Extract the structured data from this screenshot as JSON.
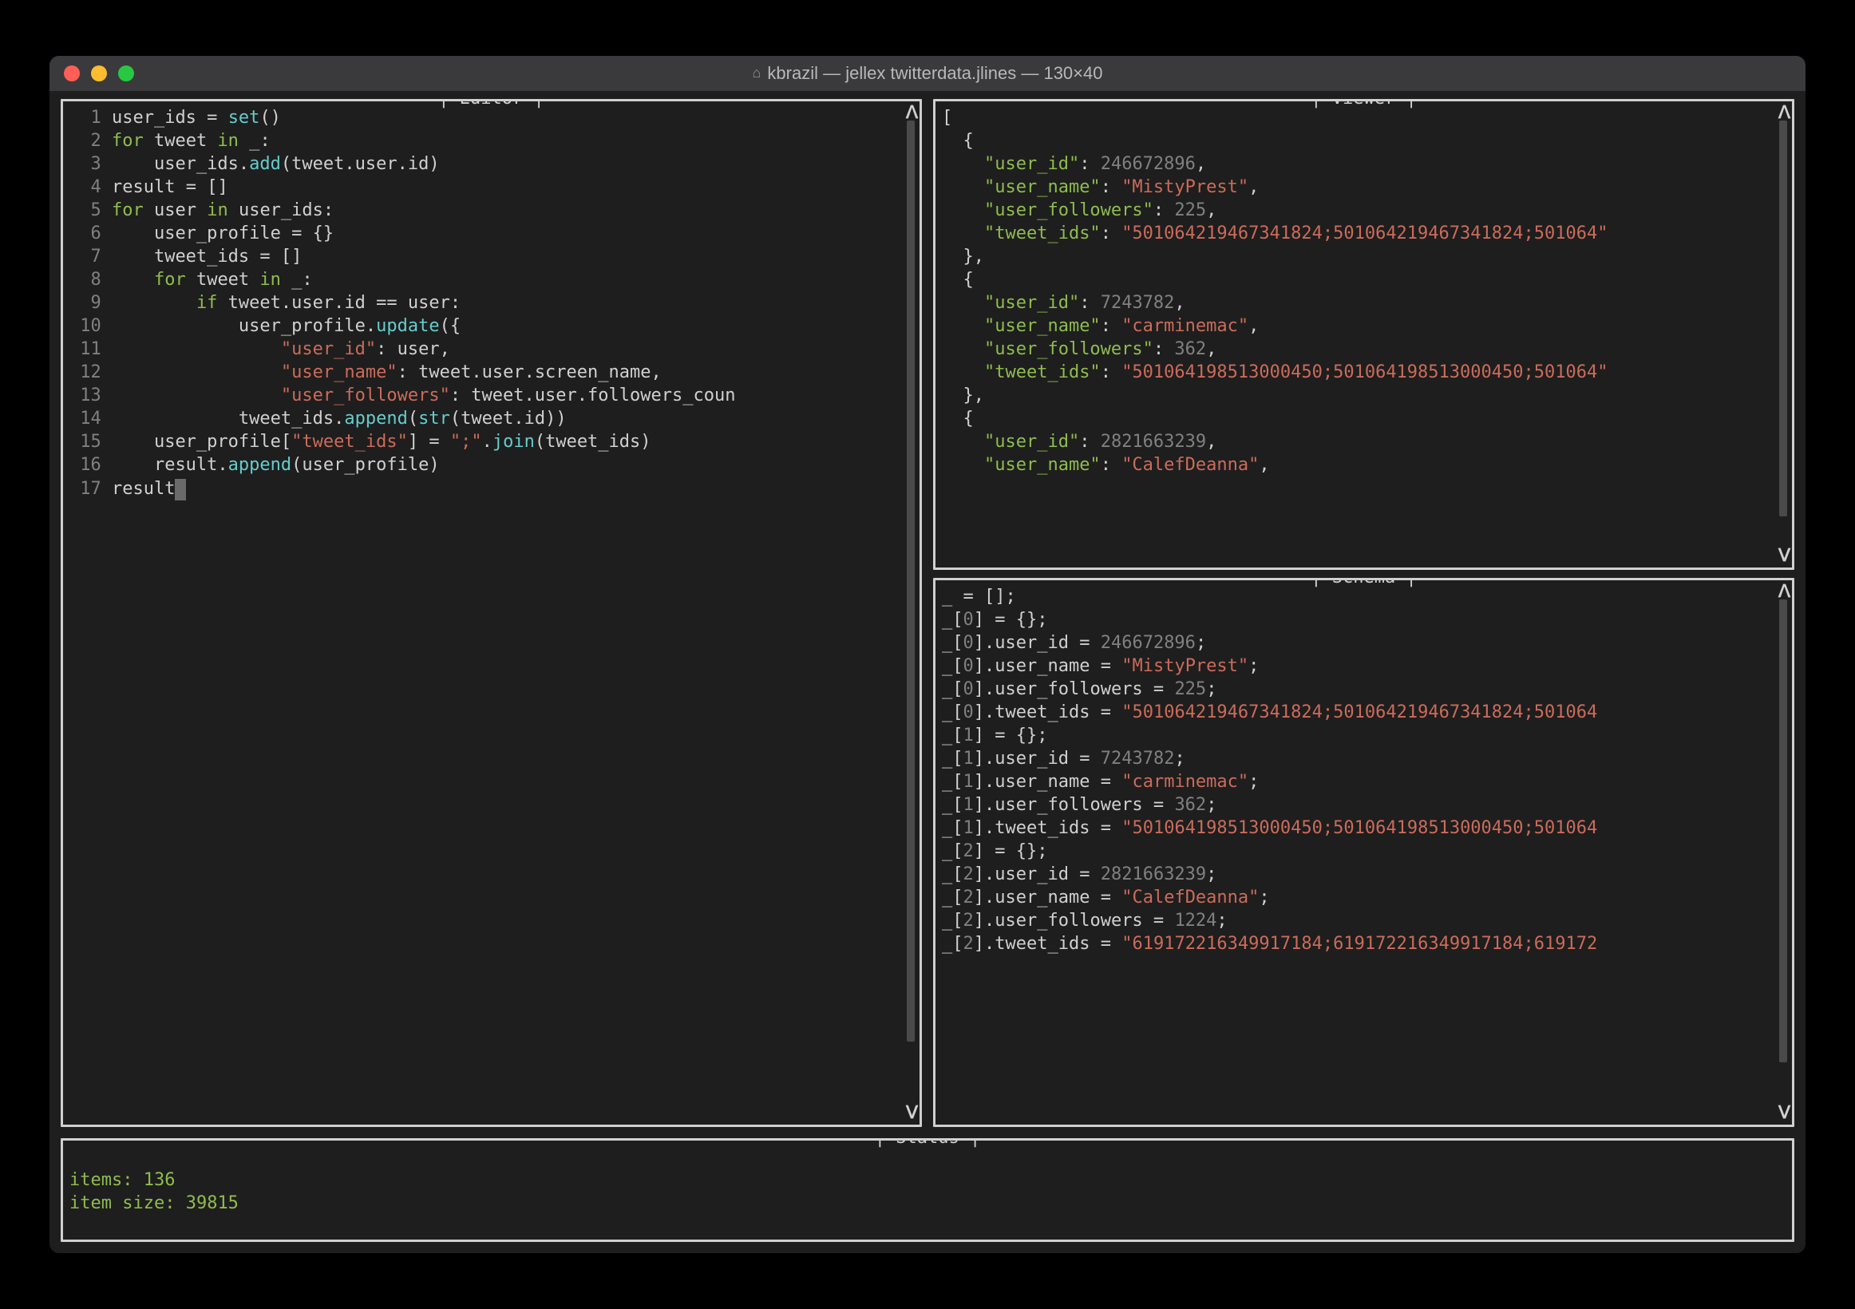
{
  "window": {
    "title_prefix": "kbrazil",
    "title_command": "jellex twitterdata.jlines",
    "title_dims": "130×40"
  },
  "panes": {
    "editor_label": "| Editor |",
    "viewer_label": "| Viewer |",
    "schema_label": "| Schema |",
    "status_label": "| Status |"
  },
  "editor": {
    "lines": [
      {
        "n": 1,
        "tokens": [
          [
            "id",
            "user_ids"
          ],
          [
            "op",
            " = "
          ],
          [
            "fn",
            "set"
          ],
          [
            "pn",
            "()"
          ]
        ]
      },
      {
        "n": 2,
        "tokens": [
          [
            "kw",
            "for"
          ],
          [
            "id",
            " tweet "
          ],
          [
            "kw",
            "in"
          ],
          [
            "id",
            " _"
          ],
          [
            "pn",
            ":"
          ]
        ]
      },
      {
        "n": 3,
        "tokens": [
          [
            "id",
            "    user_ids"
          ],
          [
            "op",
            "."
          ],
          [
            "fn",
            "add"
          ],
          [
            "pn",
            "("
          ],
          [
            "id",
            "tweet"
          ],
          [
            "op",
            "."
          ],
          [
            "id",
            "user"
          ],
          [
            "op",
            "."
          ],
          [
            "id",
            "id"
          ],
          [
            "pn",
            ")"
          ]
        ]
      },
      {
        "n": 4,
        "tokens": [
          [
            "id",
            "result"
          ],
          [
            "op",
            " = "
          ],
          [
            "pn",
            "[]"
          ]
        ]
      },
      {
        "n": 5,
        "tokens": [
          [
            "kw",
            "for"
          ],
          [
            "id",
            " user "
          ],
          [
            "kw",
            "in"
          ],
          [
            "id",
            " user_ids"
          ],
          [
            "pn",
            ":"
          ]
        ]
      },
      {
        "n": 6,
        "tokens": [
          [
            "id",
            "    user_profile"
          ],
          [
            "op",
            " = "
          ],
          [
            "pn",
            "{}"
          ]
        ]
      },
      {
        "n": 7,
        "tokens": [
          [
            "id",
            "    tweet_ids"
          ],
          [
            "op",
            " = "
          ],
          [
            "pn",
            "[]"
          ]
        ]
      },
      {
        "n": 8,
        "tokens": [
          [
            "id",
            "    "
          ],
          [
            "kw",
            "for"
          ],
          [
            "id",
            " tweet "
          ],
          [
            "kw",
            "in"
          ],
          [
            "id",
            " _"
          ],
          [
            "pn",
            ":"
          ]
        ]
      },
      {
        "n": 9,
        "tokens": [
          [
            "id",
            "        "
          ],
          [
            "kw",
            "if"
          ],
          [
            "id",
            " tweet"
          ],
          [
            "op",
            "."
          ],
          [
            "id",
            "user"
          ],
          [
            "op",
            "."
          ],
          [
            "id",
            "id"
          ],
          [
            "op",
            " == "
          ],
          [
            "id",
            "user"
          ],
          [
            "pn",
            ":"
          ]
        ]
      },
      {
        "n": 10,
        "tokens": [
          [
            "id",
            "            user_profile"
          ],
          [
            "op",
            "."
          ],
          [
            "fn",
            "update"
          ],
          [
            "pn",
            "({"
          ]
        ]
      },
      {
        "n": 11,
        "tokens": [
          [
            "id",
            "                "
          ],
          [
            "str",
            "\"user_id\""
          ],
          [
            "pn",
            ":"
          ],
          [
            "id",
            " user"
          ],
          [
            "pn",
            ","
          ]
        ]
      },
      {
        "n": 12,
        "tokens": [
          [
            "id",
            "                "
          ],
          [
            "str",
            "\"user_name\""
          ],
          [
            "pn",
            ":"
          ],
          [
            "id",
            " tweet"
          ],
          [
            "op",
            "."
          ],
          [
            "id",
            "user"
          ],
          [
            "op",
            "."
          ],
          [
            "id",
            "screen_name"
          ],
          [
            "pn",
            ","
          ]
        ]
      },
      {
        "n": 13,
        "tokens": [
          [
            "id",
            "                "
          ],
          [
            "str",
            "\"user_followers\""
          ],
          [
            "pn",
            ":"
          ],
          [
            "id",
            " tweet"
          ],
          [
            "op",
            "."
          ],
          [
            "id",
            "user"
          ],
          [
            "op",
            "."
          ],
          [
            "id",
            "followers_coun"
          ]
        ]
      },
      {
        "n": 14,
        "tokens": [
          [
            "id",
            "            tweet_ids"
          ],
          [
            "op",
            "."
          ],
          [
            "fn",
            "append"
          ],
          [
            "pn",
            "("
          ],
          [
            "fn",
            "str"
          ],
          [
            "pn",
            "("
          ],
          [
            "id",
            "tweet"
          ],
          [
            "op",
            "."
          ],
          [
            "id",
            "id"
          ],
          [
            "pn",
            "))"
          ]
        ]
      },
      {
        "n": 15,
        "tokens": [
          [
            "id",
            "    user_profile"
          ],
          [
            "pn",
            "["
          ],
          [
            "str",
            "\"tweet_ids\""
          ],
          [
            "pn",
            "]"
          ],
          [
            "op",
            " = "
          ],
          [
            "str",
            "\";\""
          ],
          [
            "op",
            "."
          ],
          [
            "fn",
            "join"
          ],
          [
            "pn",
            "("
          ],
          [
            "id",
            "tweet_ids"
          ],
          [
            "pn",
            ")"
          ]
        ]
      },
      {
        "n": 16,
        "tokens": [
          [
            "id",
            "    result"
          ],
          [
            "op",
            "."
          ],
          [
            "fn",
            "append"
          ],
          [
            "pn",
            "("
          ],
          [
            "id",
            "user_profile"
          ],
          [
            "pn",
            ")"
          ]
        ]
      },
      {
        "n": 17,
        "tokens": [
          [
            "id",
            "result"
          ]
        ],
        "cursor": true
      }
    ]
  },
  "viewer": {
    "records": [
      {
        "user_id": 246672896,
        "user_name": "MistyPrest",
        "user_followers": 225,
        "tweet_ids": "501064219467341824;501064219467341824;501064"
      },
      {
        "user_id": 7243782,
        "user_name": "carminemac",
        "user_followers": 362,
        "tweet_ids": "501064198513000450;501064198513000450;501064"
      },
      {
        "user_id": 2821663239,
        "user_name": "CalefDeanna"
      }
    ]
  },
  "schema": {
    "rows": [
      [
        [
          "id",
          "_"
        ],
        [
          "op",
          " = "
        ],
        [
          "pn",
          "[];"
        ]
      ],
      [
        [
          "id",
          "_"
        ],
        [
          "pn",
          "["
        ],
        [
          "dim",
          "0"
        ],
        [
          "pn",
          "]"
        ],
        [
          "op",
          " = "
        ],
        [
          "pn",
          "{};"
        ]
      ],
      [
        [
          "id",
          "_"
        ],
        [
          "pn",
          "["
        ],
        [
          "dim",
          "0"
        ],
        [
          "pn",
          "]"
        ],
        [
          "op",
          "."
        ],
        [
          "id",
          "user_id"
        ],
        [
          "op",
          " = "
        ],
        [
          "dim",
          "246672896"
        ],
        [
          "pn",
          ";"
        ]
      ],
      [
        [
          "id",
          "_"
        ],
        [
          "pn",
          "["
        ],
        [
          "dim",
          "0"
        ],
        [
          "pn",
          "]"
        ],
        [
          "op",
          "."
        ],
        [
          "id",
          "user_name"
        ],
        [
          "op",
          " = "
        ],
        [
          "str",
          "\"MistyPrest\""
        ],
        [
          "pn",
          ";"
        ]
      ],
      [
        [
          "id",
          "_"
        ],
        [
          "pn",
          "["
        ],
        [
          "dim",
          "0"
        ],
        [
          "pn",
          "]"
        ],
        [
          "op",
          "."
        ],
        [
          "id",
          "user_followers"
        ],
        [
          "op",
          " = "
        ],
        [
          "dim",
          "225"
        ],
        [
          "pn",
          ";"
        ]
      ],
      [
        [
          "id",
          "_"
        ],
        [
          "pn",
          "["
        ],
        [
          "dim",
          "0"
        ],
        [
          "pn",
          "]"
        ],
        [
          "op",
          "."
        ],
        [
          "id",
          "tweet_ids"
        ],
        [
          "op",
          " = "
        ],
        [
          "str",
          "\"501064219467341824;501064219467341824;501064"
        ]
      ],
      [
        [
          "id",
          "_"
        ],
        [
          "pn",
          "["
        ],
        [
          "dim",
          "1"
        ],
        [
          "pn",
          "]"
        ],
        [
          "op",
          " = "
        ],
        [
          "pn",
          "{};"
        ]
      ],
      [
        [
          "id",
          "_"
        ],
        [
          "pn",
          "["
        ],
        [
          "dim",
          "1"
        ],
        [
          "pn",
          "]"
        ],
        [
          "op",
          "."
        ],
        [
          "id",
          "user_id"
        ],
        [
          "op",
          " = "
        ],
        [
          "dim",
          "7243782"
        ],
        [
          "pn",
          ";"
        ]
      ],
      [
        [
          "id",
          "_"
        ],
        [
          "pn",
          "["
        ],
        [
          "dim",
          "1"
        ],
        [
          "pn",
          "]"
        ],
        [
          "op",
          "."
        ],
        [
          "id",
          "user_name"
        ],
        [
          "op",
          " = "
        ],
        [
          "str",
          "\"carminemac\""
        ],
        [
          "pn",
          ";"
        ]
      ],
      [
        [
          "id",
          "_"
        ],
        [
          "pn",
          "["
        ],
        [
          "dim",
          "1"
        ],
        [
          "pn",
          "]"
        ],
        [
          "op",
          "."
        ],
        [
          "id",
          "user_followers"
        ],
        [
          "op",
          " = "
        ],
        [
          "dim",
          "362"
        ],
        [
          "pn",
          ";"
        ]
      ],
      [
        [
          "id",
          "_"
        ],
        [
          "pn",
          "["
        ],
        [
          "dim",
          "1"
        ],
        [
          "pn",
          "]"
        ],
        [
          "op",
          "."
        ],
        [
          "id",
          "tweet_ids"
        ],
        [
          "op",
          " = "
        ],
        [
          "str",
          "\"501064198513000450;501064198513000450;501064"
        ]
      ],
      [
        [
          "id",
          "_"
        ],
        [
          "pn",
          "["
        ],
        [
          "dim",
          "2"
        ],
        [
          "pn",
          "]"
        ],
        [
          "op",
          " = "
        ],
        [
          "pn",
          "{};"
        ]
      ],
      [
        [
          "id",
          "_"
        ],
        [
          "pn",
          "["
        ],
        [
          "dim",
          "2"
        ],
        [
          "pn",
          "]"
        ],
        [
          "op",
          "."
        ],
        [
          "id",
          "user_id"
        ],
        [
          "op",
          " = "
        ],
        [
          "dim",
          "2821663239"
        ],
        [
          "pn",
          ";"
        ]
      ],
      [
        [
          "id",
          "_"
        ],
        [
          "pn",
          "["
        ],
        [
          "dim",
          "2"
        ],
        [
          "pn",
          "]"
        ],
        [
          "op",
          "."
        ],
        [
          "id",
          "user_name"
        ],
        [
          "op",
          " = "
        ],
        [
          "str",
          "\"CalefDeanna\""
        ],
        [
          "pn",
          ";"
        ]
      ],
      [
        [
          "id",
          "_"
        ],
        [
          "pn",
          "["
        ],
        [
          "dim",
          "2"
        ],
        [
          "pn",
          "]"
        ],
        [
          "op",
          "."
        ],
        [
          "id",
          "user_followers"
        ],
        [
          "op",
          " = "
        ],
        [
          "dim",
          "1224"
        ],
        [
          "pn",
          ";"
        ]
      ],
      [
        [
          "id",
          "_"
        ],
        [
          "pn",
          "["
        ],
        [
          "dim",
          "2"
        ],
        [
          "pn",
          "]"
        ],
        [
          "op",
          "."
        ],
        [
          "id",
          "tweet_ids"
        ],
        [
          "op",
          " = "
        ],
        [
          "str",
          "\"619172216349917184;619172216349917184;619172"
        ]
      ]
    ]
  },
  "status": {
    "items_label": "items:",
    "items_value": "136",
    "size_label": "item size:",
    "size_value": "39815"
  },
  "scroll": {
    "up": "ᐱ",
    "down": "ᐯ"
  }
}
